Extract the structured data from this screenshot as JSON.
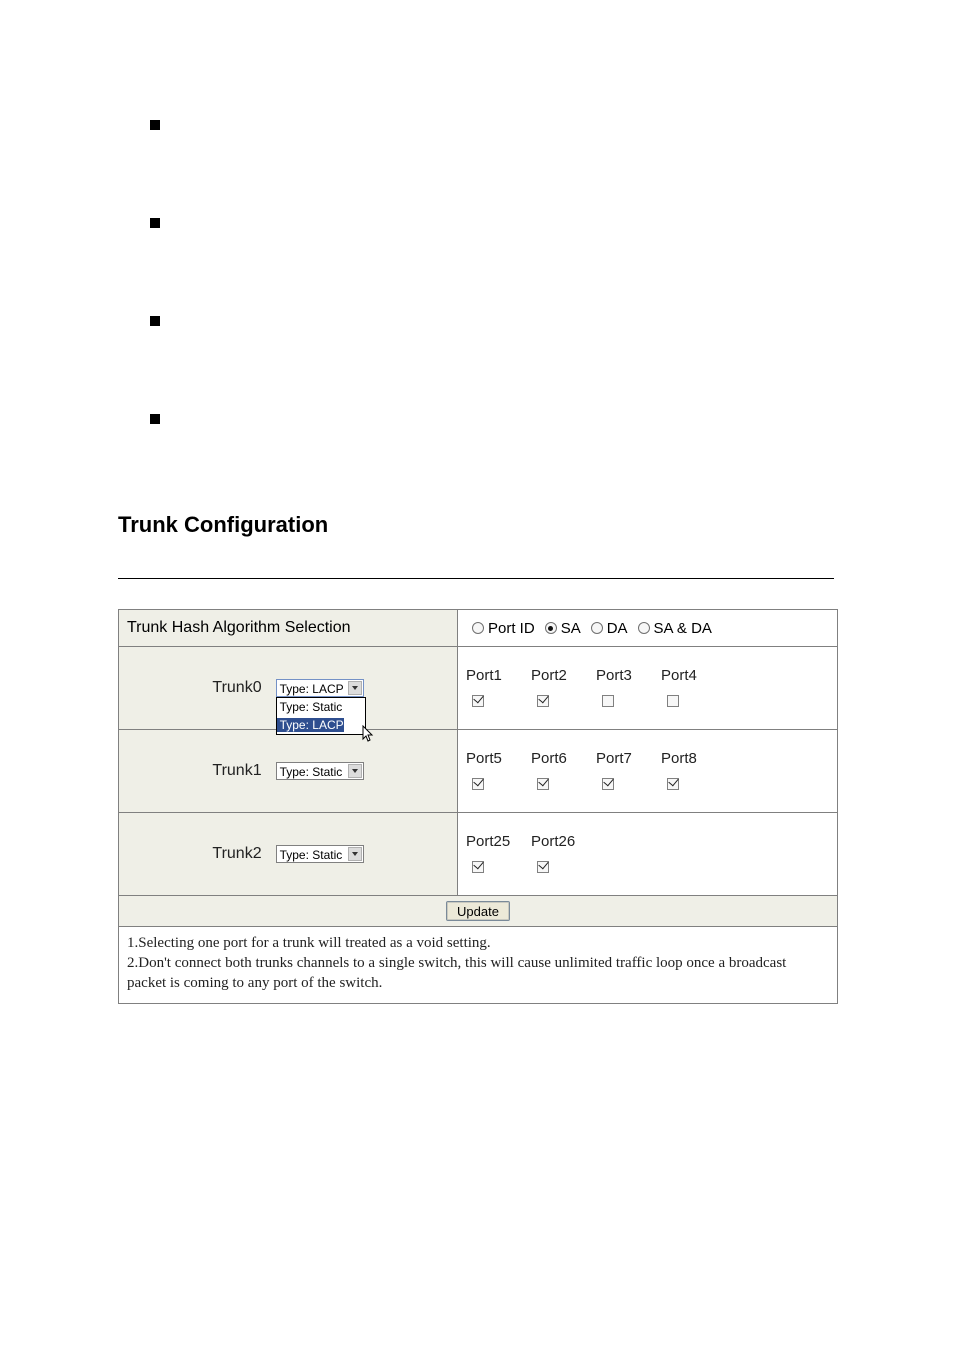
{
  "heading": "Trunk Configuration",
  "hash": {
    "title": "Trunk Hash Algorithm Selection",
    "opts": [
      "Port ID",
      "SA",
      "DA",
      "SA & DA"
    ],
    "selected": 1
  },
  "dropdown_opts": [
    "Type: Static",
    "Type: LACP"
  ],
  "trunks": [
    {
      "label": "Trunk0",
      "type_label": "Type: LACP",
      "dropdown_open": true,
      "ports": [
        {
          "name": "Port1",
          "checked": true
        },
        {
          "name": "Port2",
          "checked": true
        },
        {
          "name": "Port3",
          "checked": false
        },
        {
          "name": "Port4",
          "checked": false
        }
      ]
    },
    {
      "label": "Trunk1",
      "type_label": "Type: Static",
      "dropdown_open": false,
      "ports": [
        {
          "name": "Port5",
          "checked": true
        },
        {
          "name": "Port6",
          "checked": true
        },
        {
          "name": "Port7",
          "checked": true
        },
        {
          "name": "Port8",
          "checked": true
        }
      ]
    },
    {
      "label": "Trunk2",
      "type_label": "Type: Static",
      "dropdown_open": false,
      "ports": [
        {
          "name": "Port25",
          "checked": true
        },
        {
          "name": "Port26",
          "checked": true
        }
      ]
    }
  ],
  "update_label": "Update",
  "notes": {
    "line1": "1.Selecting one port for a trunk will treated as a void setting.",
    "line2": "2.Don't connect both trunks channels to a single switch, this will cause unlimited traffic loop once a broadcast packet is coming to any port of the switch."
  }
}
